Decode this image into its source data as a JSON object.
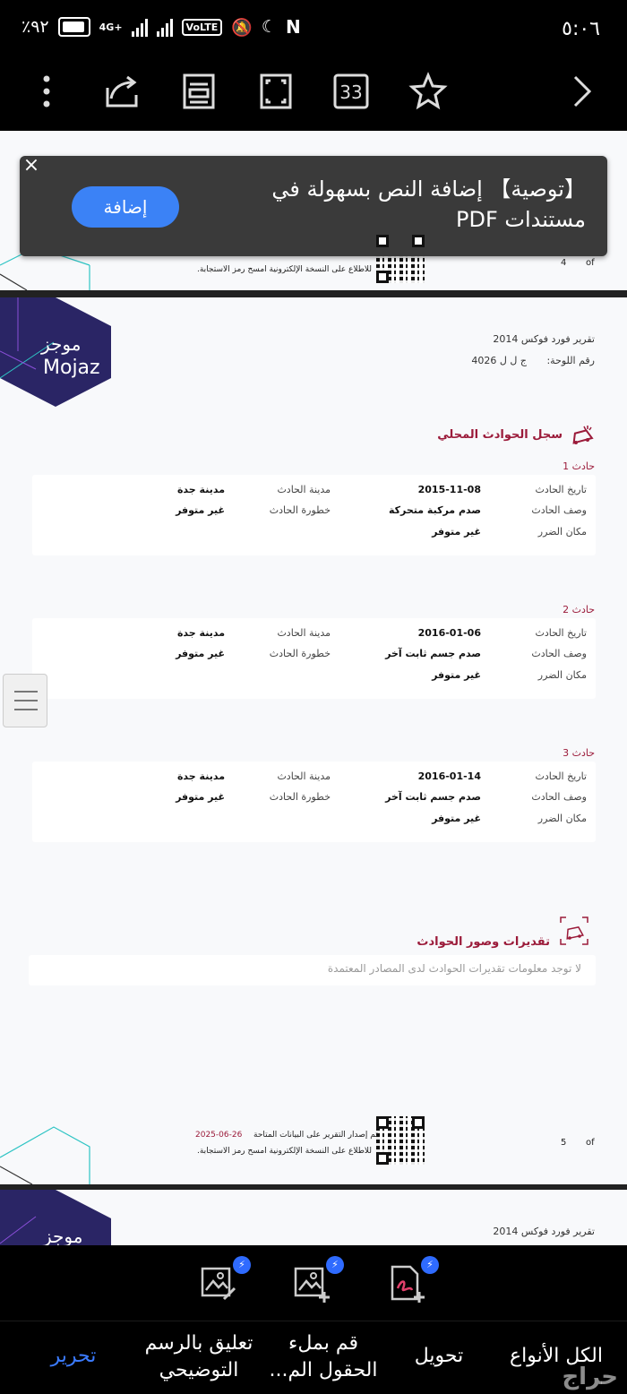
{
  "status_bar": {
    "time": "٥:٠٦",
    "battery": "٪٩٢",
    "network": "4G+",
    "volte": "VoLTE",
    "sim_slot": "2"
  },
  "toolbar": {
    "page_count": "33",
    "icons": [
      "more-vert-icon",
      "share-icon",
      "reader-mode-icon",
      "fullscreen-icon",
      "page-count-icon",
      "favorite-icon",
      "forward-icon"
    ]
  },
  "banner": {
    "text": "【توصية】 إضافة النص بسهولة في مستندات PDF",
    "button": "إضافة",
    "close": "×"
  },
  "prev_page": {
    "footer_note": "للاطلاع على النسخة الإلكترونية امسح رمز الاستجابة.",
    "page_num": "4",
    "of": "of"
  },
  "report": {
    "logo_ar": "موجز",
    "logo_en": "Mojaz",
    "title": "تقرير فورد فوكس 2014",
    "plate_label": "رقم اللوحة:",
    "plate_value": "ج ل ل 4026",
    "local_accidents_title": "سجل الحوادث المحلي",
    "field_labels": {
      "date": "تاريخ الحادث",
      "city": "مدينة الحادث",
      "description": "وصف الحادث",
      "severity": "خطورة الحادث",
      "damage_location": "مكان الضرر"
    },
    "accidents": [
      {
        "label": "حادث 1",
        "date": "2015-11-08",
        "city": "مدينة جدة",
        "description": "صدم مركبة متحركة",
        "severity": "غير متوفر",
        "damage_location": "غير متوفر"
      },
      {
        "label": "حادث 2",
        "date": "2016-01-06",
        "city": "مدينة جدة",
        "description": "صدم جسم ثابت آخر",
        "severity": "غير متوفر",
        "damage_location": "غير متوفر"
      },
      {
        "label": "حادث 3",
        "date": "2016-01-14",
        "city": "مدينة جدة",
        "description": "صدم جسم ثابت آخر",
        "severity": "غير متوفر",
        "damage_location": "غير متوفر"
      }
    ],
    "estimates_title": "تقديرات وصور الحوادث",
    "estimates_text": "لا توجد معلومات تقديرات الحوادث لدى المصادر المعتمدة",
    "footer_issued": "تم إصدار التقرير على البيانات المتاحة",
    "footer_date": "2025-06-26",
    "footer_note": "للاطلاع على النسخة الإلكترونية امسح رمز الاستجابة.",
    "page_num": "5",
    "of": "of"
  },
  "next_page": {
    "title": "تقرير فورد فوكس 2014",
    "logo_ar": "موجز"
  },
  "bottom_tools": {
    "badge": "⚡",
    "icons": [
      "image-edit-icon",
      "image-add-icon",
      "pdf-sign-icon"
    ]
  },
  "bottom_tabs": [
    {
      "label": "الكل الأنواع",
      "active": false
    },
    {
      "label": "تحويل",
      "active": false
    },
    {
      "label": "قم بملء الحقول الم...",
      "active": false
    },
    {
      "label": "تعليق بالرسم التوضيحي",
      "active": false
    },
    {
      "label": "تحرير",
      "active": true
    }
  ],
  "watermark": "حراج"
}
